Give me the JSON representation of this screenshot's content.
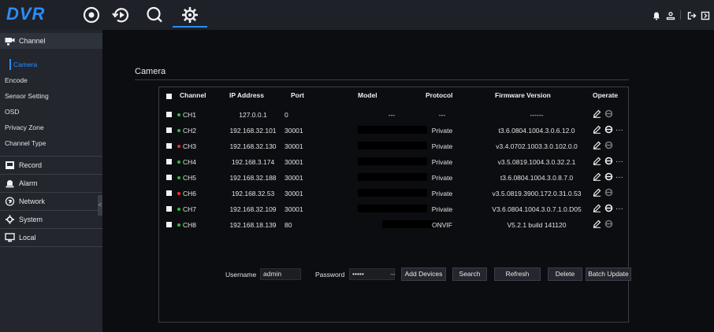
{
  "app": {
    "logo": "DVR"
  },
  "topnav": [
    {
      "name": "live-view-icon"
    },
    {
      "name": "playback-icon"
    },
    {
      "name": "search-icon"
    },
    {
      "name": "settings-icon",
      "active": true
    }
  ],
  "topright": [
    {
      "name": "notification-bell-icon"
    },
    {
      "name": "user-icon"
    },
    {
      "name": "logout-icon"
    },
    {
      "name": "shutdown-icon"
    }
  ],
  "sidebar": {
    "sections": [
      {
        "key": "channel",
        "label": "Channel",
        "icon": "camera-icon",
        "expanded": true
      },
      {
        "key": "record",
        "label": "Record",
        "icon": "record-icon"
      },
      {
        "key": "alarm",
        "label": "Alarm",
        "icon": "alarm-icon"
      },
      {
        "key": "network",
        "label": "Network",
        "icon": "network-icon"
      },
      {
        "key": "system",
        "label": "System",
        "icon": "system-icon"
      },
      {
        "key": "local",
        "label": "Local",
        "icon": "local-icon"
      }
    ],
    "channel_items": [
      "Camera",
      "Encode",
      "Sensor Setting",
      "OSD",
      "Privacy Zone",
      "Channel Type"
    ],
    "active_item": "Camera",
    "collapse_glyph": "<"
  },
  "page": {
    "title": "Camera"
  },
  "table": {
    "headers": {
      "channel": "Channel",
      "ip": "IP Address",
      "port": "Port",
      "model": "Model",
      "protocol": "Protocol",
      "firmware": "Firmware Version",
      "operate": "Operate"
    },
    "rows": [
      {
        "channel": "CH1",
        "status": "online",
        "ip": "127.0.0.1",
        "port": "0",
        "model": "---",
        "protocol": "---",
        "firmware": "------",
        "more": false
      },
      {
        "channel": "CH2",
        "status": "online",
        "ip": "192.168.32.101",
        "port": "30001",
        "model": "",
        "protocol": "Private",
        "firmware": "t3.6.0804.1004.3.0.6.12.0",
        "more": true
      },
      {
        "channel": "CH3",
        "status": "offline",
        "ip": "192.168.32.130",
        "port": "30001",
        "model": "",
        "protocol": "Private",
        "firmware": "v3.4.0702.1003.3.0.102.0.0",
        "more": false
      },
      {
        "channel": "CH4",
        "status": "online",
        "ip": "192.168.3.174",
        "port": "30001",
        "model": "",
        "protocol": "Private",
        "firmware": "v3.5.0819.1004.3.0.32.2.1",
        "more": true
      },
      {
        "channel": "CH5",
        "status": "online",
        "ip": "192.168.32.188",
        "port": "30001",
        "model": "",
        "protocol": "Private",
        "firmware": "t3.6.0804.1004.3.0.8.7.0",
        "more": true
      },
      {
        "channel": "CH6",
        "status": "offline",
        "ip": "192.168.32.53",
        "port": "30001",
        "model": "",
        "protocol": "Private",
        "firmware": "v3.5.0819.3900.172.0.31.0.53",
        "more": false
      },
      {
        "channel": "CH7",
        "status": "online",
        "ip": "192.168.32.109",
        "port": "30001",
        "model": "",
        "protocol": "Private",
        "firmware": "V3.6.0804.1004.3.0.7.1.0.D05",
        "more": true
      },
      {
        "channel": "CH8",
        "status": "online",
        "ip": "192.168.18.139",
        "port": "80",
        "model": "",
        "protocol": "ONVIF",
        "firmware": "V5.2.1 build 141120",
        "more": false
      }
    ],
    "more_glyph": "···"
  },
  "footer": {
    "username_label": "Username",
    "username_value": "admin",
    "password_label": "Password",
    "password_value": "•••••",
    "buttons": {
      "add_devices": "Add Devices",
      "search": "Search",
      "refresh": "Refresh",
      "delete": "Delete",
      "batch_update": "Batch Update"
    }
  },
  "colors": {
    "accent": "#2a8cff",
    "online": "#22c334",
    "offline": "#ff2a2a",
    "background": "#0c0d10",
    "sidebar": "#23262d"
  }
}
